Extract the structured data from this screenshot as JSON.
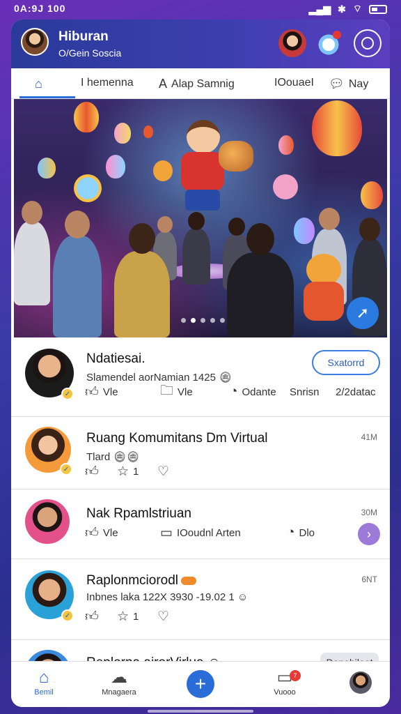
{
  "status_bar": {
    "time": "0A:9J 100"
  },
  "header": {
    "title": "Hiburan",
    "subtitle": "O/Gein Soscia"
  },
  "tabs": [
    {
      "label": "",
      "icon": "home-icon"
    },
    {
      "label": "I hemenna"
    },
    {
      "label": "Alap Samnig",
      "icon": "a-icon"
    },
    {
      "label": "IOouaeI"
    },
    {
      "label": "Nay",
      "icon": "chat-icon"
    }
  ],
  "carousel": {
    "pages": 5,
    "active_page": 2
  },
  "feed": [
    {
      "name": "Ndatiesai.",
      "meta": "Slamendel aorNamian 1425",
      "button": "Sxatorrd",
      "actions": [
        "Vle",
        "Vle",
        "Odante",
        "Snrisn",
        "2/2datac"
      ]
    },
    {
      "name": "Ruang Komumitans Dm Virtual",
      "meta": "Tlard",
      "time": "41M",
      "actions": [
        "",
        "1",
        ""
      ]
    },
    {
      "name": "Nak Rpamlstriuan",
      "time": "30M",
      "actions": [
        "Vle",
        "IOoudnl Arten",
        "Dlo"
      ]
    },
    {
      "name": "Raplonmciorodl",
      "meta": "Inbnes laka 122X 3930 -19.02 1",
      "time": "6NT",
      "actions": [
        "",
        "1",
        ""
      ]
    },
    {
      "name": "Replorna airorVirlua",
      "button": "Danobiloot"
    }
  ],
  "bottom_nav": [
    {
      "label": "Bemil",
      "icon": "home-icon",
      "active": true
    },
    {
      "label": "Mnagaera",
      "icon": "group-icon"
    },
    {
      "label": "",
      "icon": "plus-icon"
    },
    {
      "label": "Vuooo",
      "icon": "video-icon",
      "badge": "7"
    },
    {
      "label": "",
      "icon": "avatar"
    }
  ]
}
